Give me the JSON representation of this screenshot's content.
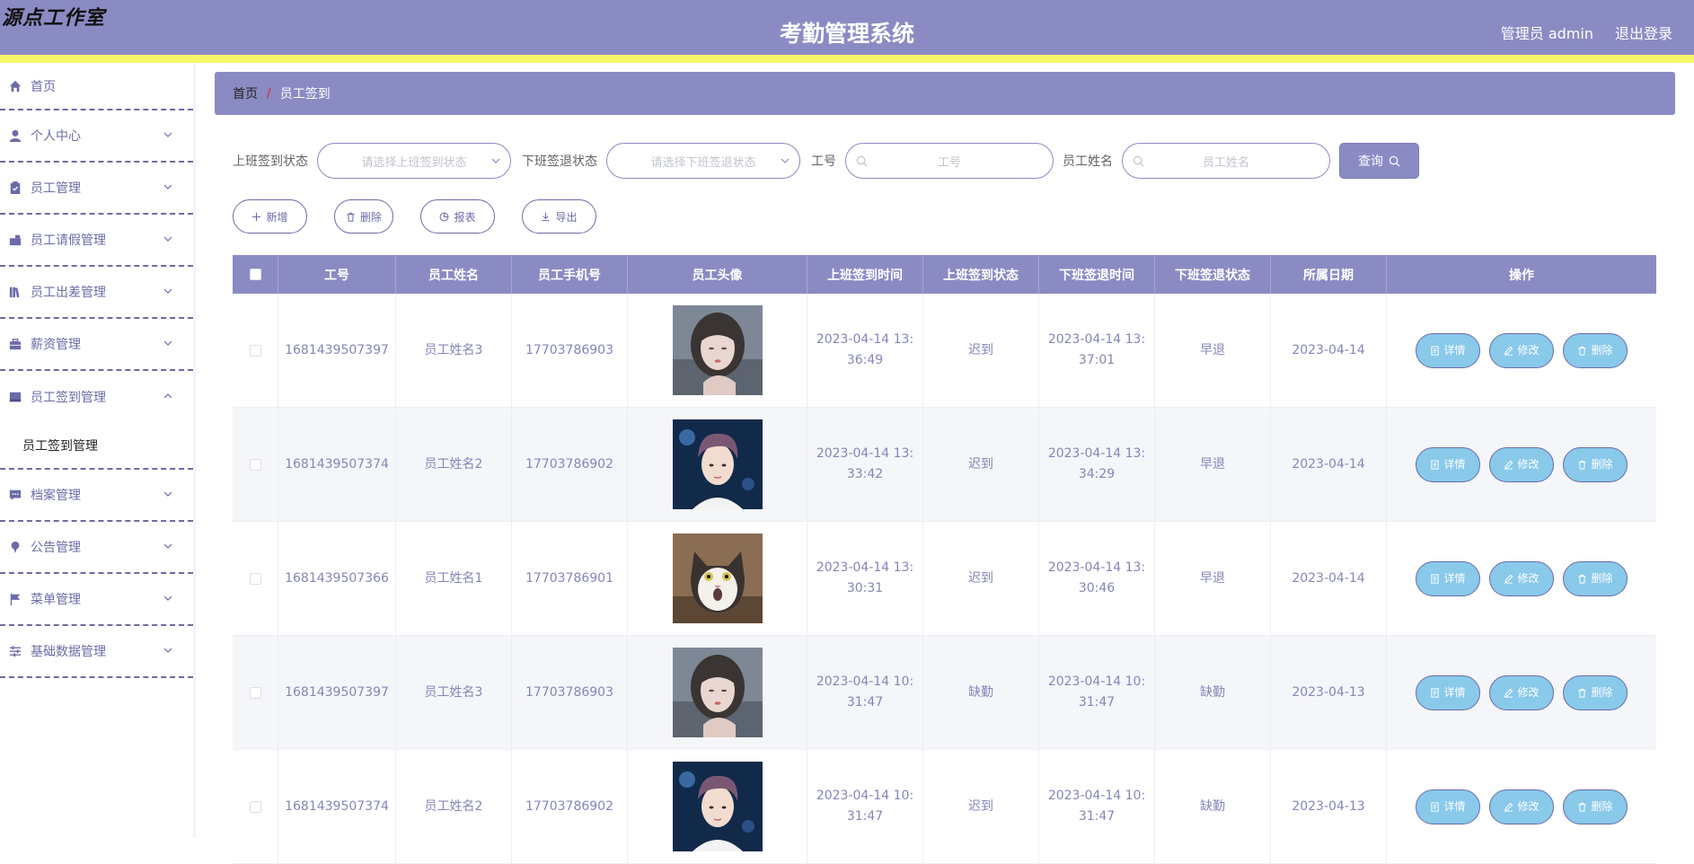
{
  "header": {
    "logo": "源点工作室",
    "title": "考勤管理系统",
    "user": "管理员 admin",
    "logout": "退出登录"
  },
  "sidebar": {
    "items": [
      {
        "label": "首页",
        "icon": "home-icon"
      },
      {
        "label": "个人中心",
        "icon": "user-icon"
      },
      {
        "label": "员工管理",
        "icon": "clipboard-icon"
      },
      {
        "label": "员工请假管理",
        "icon": "briefcase-icon"
      },
      {
        "label": "员工出差管理",
        "icon": "books-icon"
      },
      {
        "label": "薪资管理",
        "icon": "toolbox-icon"
      },
      {
        "label": "员工签到管理",
        "icon": "inbox-icon",
        "sub": "员工签到管理"
      },
      {
        "label": "档案管理",
        "icon": "message-icon"
      },
      {
        "label": "公告管理",
        "icon": "pin-icon"
      },
      {
        "label": "菜单管理",
        "icon": "flag-icon"
      },
      {
        "label": "基础数据管理",
        "icon": "sliders-icon"
      }
    ]
  },
  "breadcrumb": {
    "home": "首页",
    "sep": "/",
    "current": "员工签到"
  },
  "search": {
    "in_status_label": "上班签到状态",
    "in_status_placeholder": "请选择上班签到状态",
    "out_status_label": "下班签退状态",
    "out_status_placeholder": "请选择下班签退状态",
    "empno_label": "工号",
    "empno_placeholder": "工号",
    "name_label": "员工姓名",
    "name_placeholder": "员工姓名",
    "query_label": "查询"
  },
  "actions": {
    "add": "新增",
    "delete": "删除",
    "report": "报表",
    "export": "导出"
  },
  "table": {
    "columns": [
      "工号",
      "员工姓名",
      "员工手机号",
      "员工头像",
      "上班签到时间",
      "上班签到状态",
      "下班签退时间",
      "下班签退状态",
      "所属日期",
      "操作"
    ],
    "ops": {
      "detail": "详情",
      "edit": "修改",
      "delete": "删除"
    },
    "rows": [
      {
        "empno": "1681439507397",
        "name": "员工姓名3",
        "phone": "17703786903",
        "avatar": "girl",
        "in_time_1": "2023-04-14 13:",
        "in_time_2": "36:49",
        "in_status": "迟到",
        "out_time_1": "2023-04-14 13:",
        "out_time_2": "37:01",
        "out_status": "早退",
        "date": "2023-04-14"
      },
      {
        "empno": "1681439507374",
        "name": "员工姓名2",
        "phone": "17703786902",
        "avatar": "boy",
        "in_time_1": "2023-04-14 13:",
        "in_time_2": "33:42",
        "in_status": "迟到",
        "out_time_1": "2023-04-14 13:",
        "out_time_2": "34:29",
        "out_status": "早退",
        "date": "2023-04-14"
      },
      {
        "empno": "1681439507366",
        "name": "员工姓名1",
        "phone": "17703786901",
        "avatar": "cat",
        "in_time_1": "2023-04-14 13:",
        "in_time_2": "30:31",
        "in_status": "迟到",
        "out_time_1": "2023-04-14 13:",
        "out_time_2": "30:46",
        "out_status": "早退",
        "date": "2023-04-14"
      },
      {
        "empno": "1681439507397",
        "name": "员工姓名3",
        "phone": "17703786903",
        "avatar": "girl",
        "in_time_1": "2023-04-14 10:",
        "in_time_2": "31:47",
        "in_status": "缺勤",
        "out_time_1": "2023-04-14 10:",
        "out_time_2": "31:47",
        "out_status": "缺勤",
        "date": "2023-04-13"
      },
      {
        "empno": "1681439507374",
        "name": "员工姓名2",
        "phone": "17703786902",
        "avatar": "boy",
        "in_time_1": "2023-04-14 10:",
        "in_time_2": "31:47",
        "in_status": "迟到",
        "out_time_1": "2023-04-14 10:",
        "out_time_2": "31:47",
        "out_status": "缺勤",
        "date": "2023-04-13"
      }
    ]
  },
  "colors": {
    "primary": "#8b8bc4",
    "accent_yellow": "#f6f66a",
    "op_button": "#89c9ea",
    "text_purple": "#6b6ba8"
  }
}
